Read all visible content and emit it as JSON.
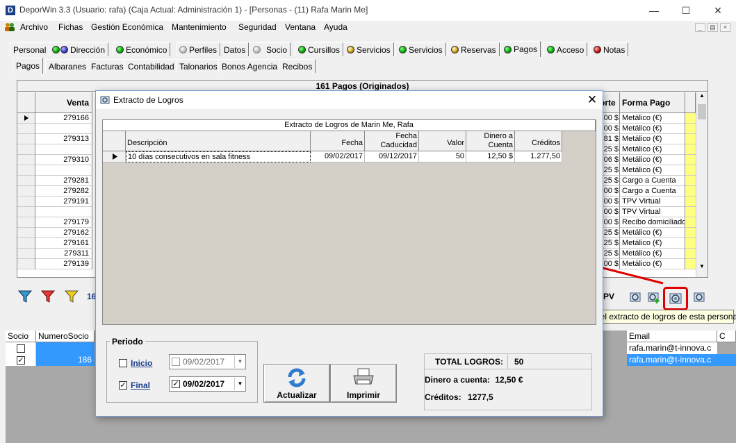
{
  "window": {
    "title": "DeporWin 3.3  (Usuario: rafa)  (Caja Actual: Administración 1) - [Personas - (11) Rafa Marin Me]",
    "app_icon_letter": "D"
  },
  "menu": [
    "Archivo",
    "Fichas",
    "Gestión Económica",
    "Mantenimiento",
    "Seguridad",
    "Ventana",
    "Ayuda"
  ],
  "tabs_main": [
    {
      "label": "Personal",
      "dot": ""
    },
    {
      "label": "Dirección",
      "dot": "green-blue"
    },
    {
      "label": "Económico",
      "dot": "green"
    },
    {
      "label": "Perfiles",
      "dot": "grey"
    },
    {
      "label": "Datos",
      "dot": ""
    },
    {
      "label": "Socio",
      "dot": "grey"
    },
    {
      "label": "Cursillos",
      "dot": "green"
    },
    {
      "label": "Servicios",
      "dot": "yellow"
    },
    {
      "label": "Servicios",
      "dot": "green"
    },
    {
      "label": "Reservas",
      "dot": "yellow"
    },
    {
      "label": "Pagos",
      "dot": "green"
    },
    {
      "label": "Acceso",
      "dot": "green"
    },
    {
      "label": "Notas",
      "dot": "red"
    }
  ],
  "tabs_sub": [
    "Pagos",
    "Albaranes",
    "Facturas",
    "Contabilidad",
    "Talonarios",
    "Bonos Agencia",
    "Recibos"
  ],
  "pagos_grid": {
    "caption": "161 Pagos (Originados)",
    "col_venta": "Venta",
    "col_importe_partial": "orte",
    "col_forma_pago": "Forma Pago",
    "ventas": [
      "279166",
      "",
      "279313",
      "",
      "279310",
      "",
      "279281",
      "279282",
      "279191",
      "",
      "279179",
      "279162",
      "279161",
      "279311",
      "279139"
    ],
    "importes": [
      "00 $",
      "00 $",
      "81 $",
      "25 $",
      "06 $",
      "25 $",
      "25 $",
      "00 $",
      "00 $",
      "00 $",
      "00 $",
      "25 $",
      "25 $",
      "25 $",
      "00 $"
    ],
    "formas": [
      "Metálico (€)",
      "Metálico (€)",
      "Metálico (€)",
      "Metálico (€)",
      "Metálico (€)",
      "Metálico (€)",
      "Cargo a Cuenta",
      "Cargo a Cuenta",
      "TPV Virtual",
      "TPV Virtual",
      "Recibo domiciliado",
      "Metálico (€)",
      "Metálico (€)",
      "Metálico (€)",
      "Metálico (€)"
    ]
  },
  "toolbar": {
    "count_partial": "16",
    "tpv_partial": "PV"
  },
  "tooltip": "Muestra el extracto de logros de esta persona",
  "modal": {
    "title": "Extracto de Logros",
    "grid_caption": "Extracto de Logros de Marin Me, Rafa",
    "headers": {
      "descripcion": "Descripción",
      "fecha": "Fecha",
      "fecha_caducidad_1": "Fecha",
      "fecha_caducidad_2": "Caducidad",
      "valor": "Valor",
      "dinero_1": "Dinero a",
      "dinero_2": "Cuenta",
      "creditos": "Créditos"
    },
    "row": {
      "descripcion": "10 días consecutivos en sala fitness",
      "fecha": "09/02/2017",
      "fecha_caducidad": "09/12/2017",
      "valor": "50",
      "dinero": "12,50 $",
      "creditos": "1.277,50"
    },
    "periodo": {
      "legend": "Periodo",
      "inicio_label": "Inicio",
      "inicio_checked": false,
      "inicio_date": "09/02/2017",
      "final_label": "Final",
      "final_checked": true,
      "final_date": "09/02/2017"
    },
    "btn_actualizar": "Actualizar",
    "btn_imprimir": "Imprimir",
    "totals": {
      "total_label": "TOTAL LOGROS:",
      "total_value": "50",
      "dinero_label": "Dinero a cuenta:",
      "dinero_value": "12,50 €",
      "creditos_label": "Créditos:",
      "creditos_value": "1277,5"
    }
  },
  "socio_grid": {
    "col_socio": "Socio",
    "col_numero": "NumeroSocio",
    "col_email": "Email",
    "col_c": "C",
    "rows": [
      {
        "checked": false,
        "numero": "",
        "email": "rafa.marin@t-innova.c"
      },
      {
        "checked": true,
        "numero": "186",
        "email": "rafa.marin@t-innova.c"
      }
    ]
  },
  "colors": {
    "selection": "#3399ff",
    "highlight_yellow": "#ffff80",
    "annotation_red": "#e00000"
  }
}
